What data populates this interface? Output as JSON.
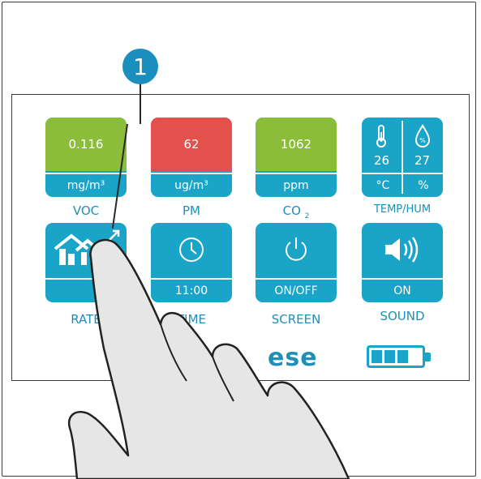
{
  "callout": {
    "number": "1"
  },
  "tiles": {
    "voc": {
      "value": "0.116",
      "unit": "mg/m³",
      "label": "VOC"
    },
    "pm": {
      "value": "62",
      "unit": "ug/m³",
      "label": "PM"
    },
    "co2": {
      "value": "1062",
      "unit": "ppm",
      "label": "CO",
      "label_sub": "2"
    },
    "temphum": {
      "temp": "26",
      "hum": "27",
      "temp_unit": "°C",
      "hum_unit": "%",
      "label": "TEMP/HUM"
    },
    "rate": {
      "label": "RATE"
    },
    "time": {
      "value": "11:00",
      "label": "TIME"
    },
    "screen": {
      "value": "ON/OFF",
      "label": "SCREEN"
    },
    "sound": {
      "value": "ON",
      "label": "SOUND"
    }
  },
  "brand": {
    "text": "ese"
  },
  "battery": {
    "level_fraction": 0.6
  },
  "colors": {
    "accent": "#1aa4c8",
    "good": "#8bbd3a",
    "bad": "#e4504b"
  }
}
